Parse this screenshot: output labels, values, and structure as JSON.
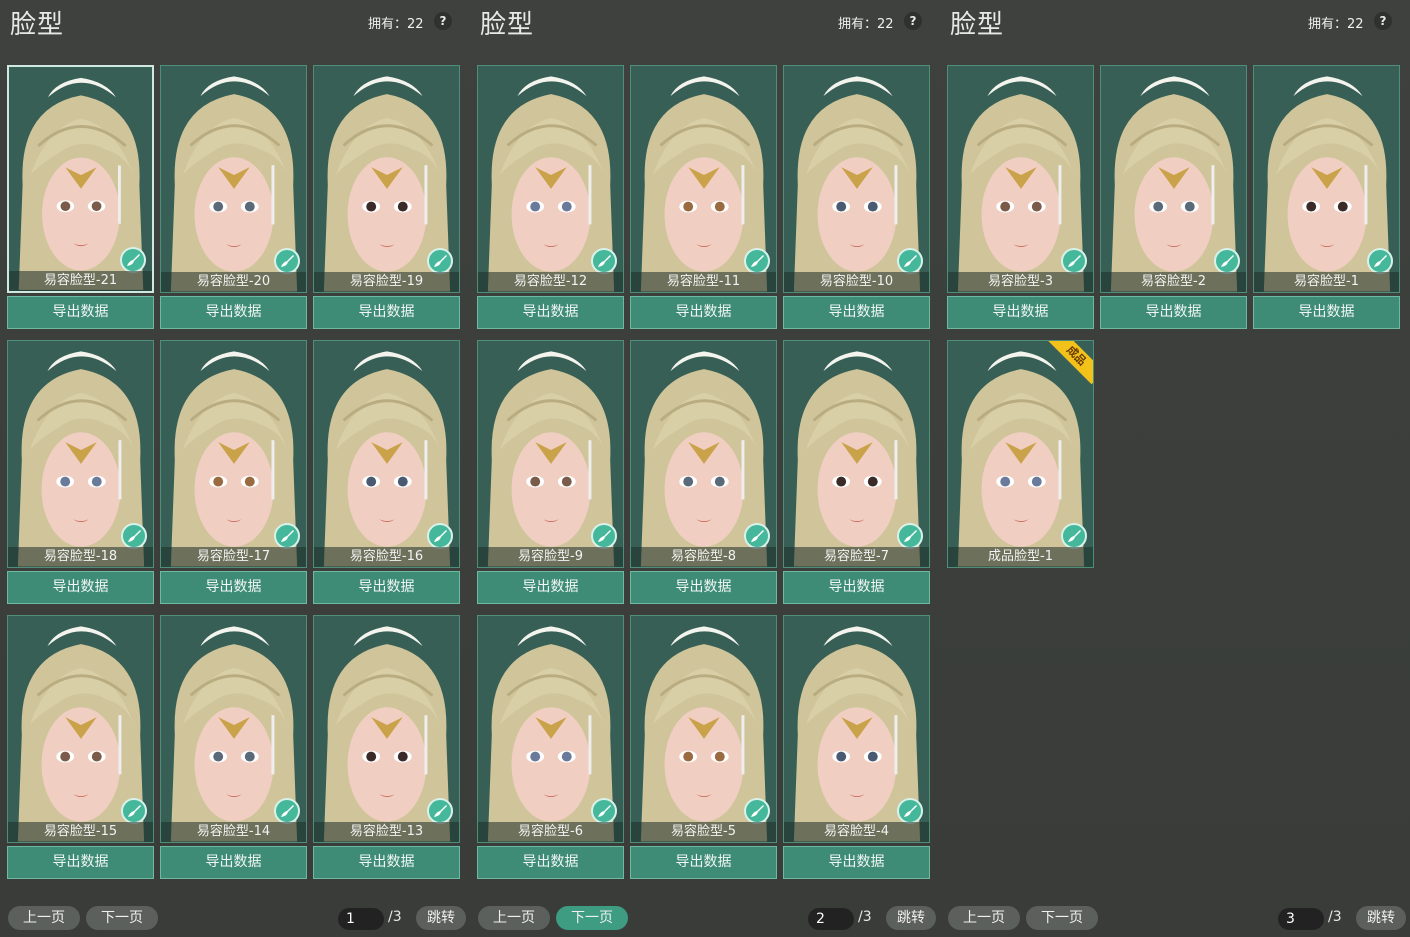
{
  "panels": [
    {
      "title": "脸型",
      "owned": "拥有：22",
      "help": "?",
      "cards": [
        {
          "label": "易容脸型-21",
          "selected": true
        },
        {
          "label": "易容脸型-20"
        },
        {
          "label": "易容脸型-19"
        },
        {
          "label": "易容脸型-18"
        },
        {
          "label": "易容脸型-17"
        },
        {
          "label": "易容脸型-16"
        },
        {
          "label": "易容脸型-15"
        },
        {
          "label": "易容脸型-14"
        },
        {
          "label": "易容脸型-13"
        }
      ],
      "export_label": "导出数据",
      "prev": "上一页",
      "next": "下一页",
      "next_active": false,
      "page": "1",
      "total": "/3",
      "jump": "跳转"
    },
    {
      "title": "脸型",
      "owned": "拥有：22",
      "help": "?",
      "cards": [
        {
          "label": "易容脸型-12"
        },
        {
          "label": "易容脸型-11"
        },
        {
          "label": "易容脸型-10"
        },
        {
          "label": "易容脸型-9"
        },
        {
          "label": "易容脸型-8"
        },
        {
          "label": "易容脸型-7"
        },
        {
          "label": "易容脸型-6"
        },
        {
          "label": "易容脸型-5"
        },
        {
          "label": "易容脸型-4"
        }
      ],
      "export_label": "导出数据",
      "prev": "上一页",
      "next": "下一页",
      "next_active": true,
      "page": "2",
      "total": "/3",
      "jump": "跳转"
    },
    {
      "title": "脸型",
      "owned": "拥有：22",
      "help": "?",
      "cards": [
        {
          "label": "易容脸型-3"
        },
        {
          "label": "易容脸型-2"
        },
        {
          "label": "易容脸型-1"
        },
        {
          "label": "成品脸型-1",
          "ribbon": "成品",
          "no_export": true
        }
      ],
      "export_label": "导出数据",
      "prev": "上一页",
      "next": "下一页",
      "next_active": false,
      "page": "3",
      "total": "/3",
      "jump": "跳转"
    }
  ],
  "colors": {
    "accent": "#3e8c76",
    "card_bg": "#385f56",
    "hair": "#d9cfa6",
    "skin": "#f0cfc2",
    "ribbon": "#f2c21a"
  },
  "icons": {
    "card": "brush-icon"
  }
}
